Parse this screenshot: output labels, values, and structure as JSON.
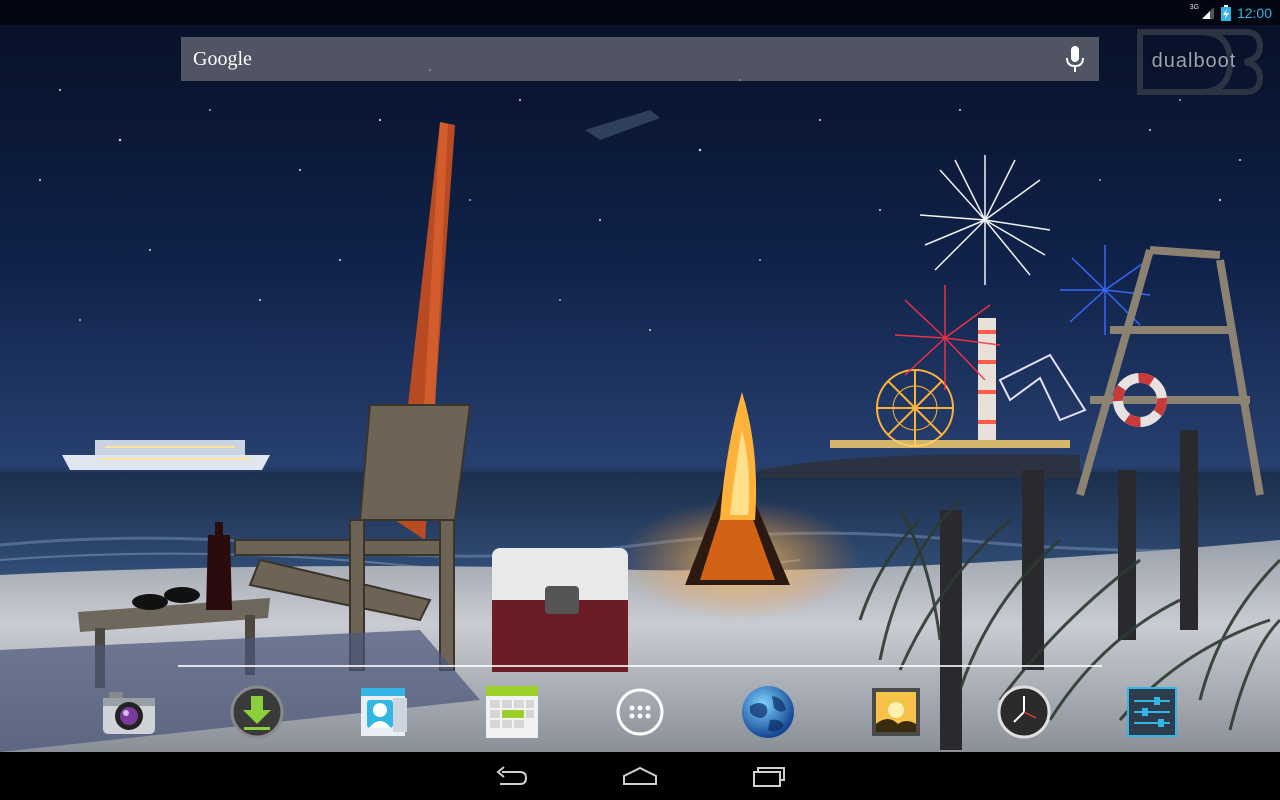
{
  "status_bar": {
    "time": "12:00",
    "network_type": "3G",
    "icons": [
      "signal-icon",
      "battery-charging-icon"
    ]
  },
  "search": {
    "label": "Google",
    "voice_icon": "mic-icon"
  },
  "logo": {
    "text": "dualboot"
  },
  "dock": {
    "apps": [
      {
        "name": "Camera",
        "icon": "camera-icon"
      },
      {
        "name": "Downloads",
        "icon": "download-icon"
      },
      {
        "name": "People",
        "icon": "contacts-icon"
      },
      {
        "name": "Calendar",
        "icon": "calendar-icon"
      },
      {
        "name": "Apps",
        "icon": "app-drawer-icon"
      },
      {
        "name": "Browser",
        "icon": "globe-icon"
      },
      {
        "name": "Gallery",
        "icon": "gallery-icon"
      },
      {
        "name": "Clock",
        "icon": "clock-icon"
      },
      {
        "name": "Settings",
        "icon": "settings-icon"
      }
    ]
  },
  "nav_bar": {
    "buttons": [
      "back-icon",
      "home-icon",
      "recents-icon"
    ]
  },
  "colors": {
    "accent": "#33b5e5",
    "sky_top": "#0a1630",
    "sky_mid": "#1d3a6e",
    "sand": "#c8ccd2"
  }
}
